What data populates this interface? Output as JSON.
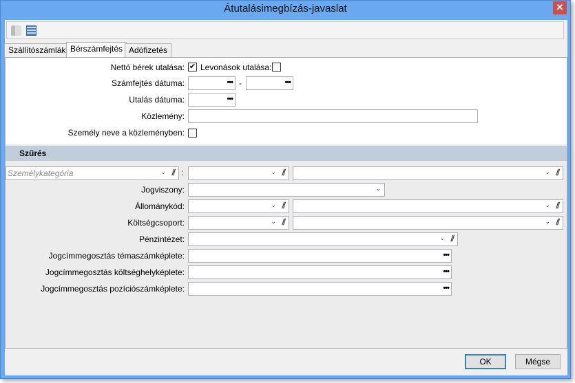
{
  "window": {
    "title": "Átutalásimegbízás-javaslat",
    "close": "✕"
  },
  "tabs": [
    "Szállítószámlák",
    "Bérszámfejtés",
    "Adófizetés"
  ],
  "form": {
    "netto_label": "Nettó bérek utalása:",
    "netto_checked": true,
    "netto_mark": "✔",
    "levonas_label": "Levonások utalása:",
    "szamfejtes_label": "Számfejtés dátuma:",
    "range_sep": "-",
    "utalas_label": "Utalás dátuma:",
    "kozlemeny_label": "Közlemény:",
    "szemely_label": "Személy neve a közleményben:"
  },
  "filter": {
    "title": "Szűrés",
    "category_placeholder": "Személykategória",
    "colon": ":",
    "jogviszony": "Jogviszony:",
    "allomany": "Állománykód:",
    "koltseg": "Költségcsoport:",
    "penz": "Pénzintézet:",
    "tema": "Jogcímmegosztás témaszámképlete:",
    "koltseghely": "Jogcímmegosztás költséghelyképlete:",
    "pozicio": "Jogcímmegosztás pozíciószámképlete:"
  },
  "icons": {
    "ellipsis": "•••",
    "chevron": "⌄",
    "clip": "⫽"
  },
  "buttons": {
    "ok": "OK",
    "cancel": "Mégse"
  }
}
